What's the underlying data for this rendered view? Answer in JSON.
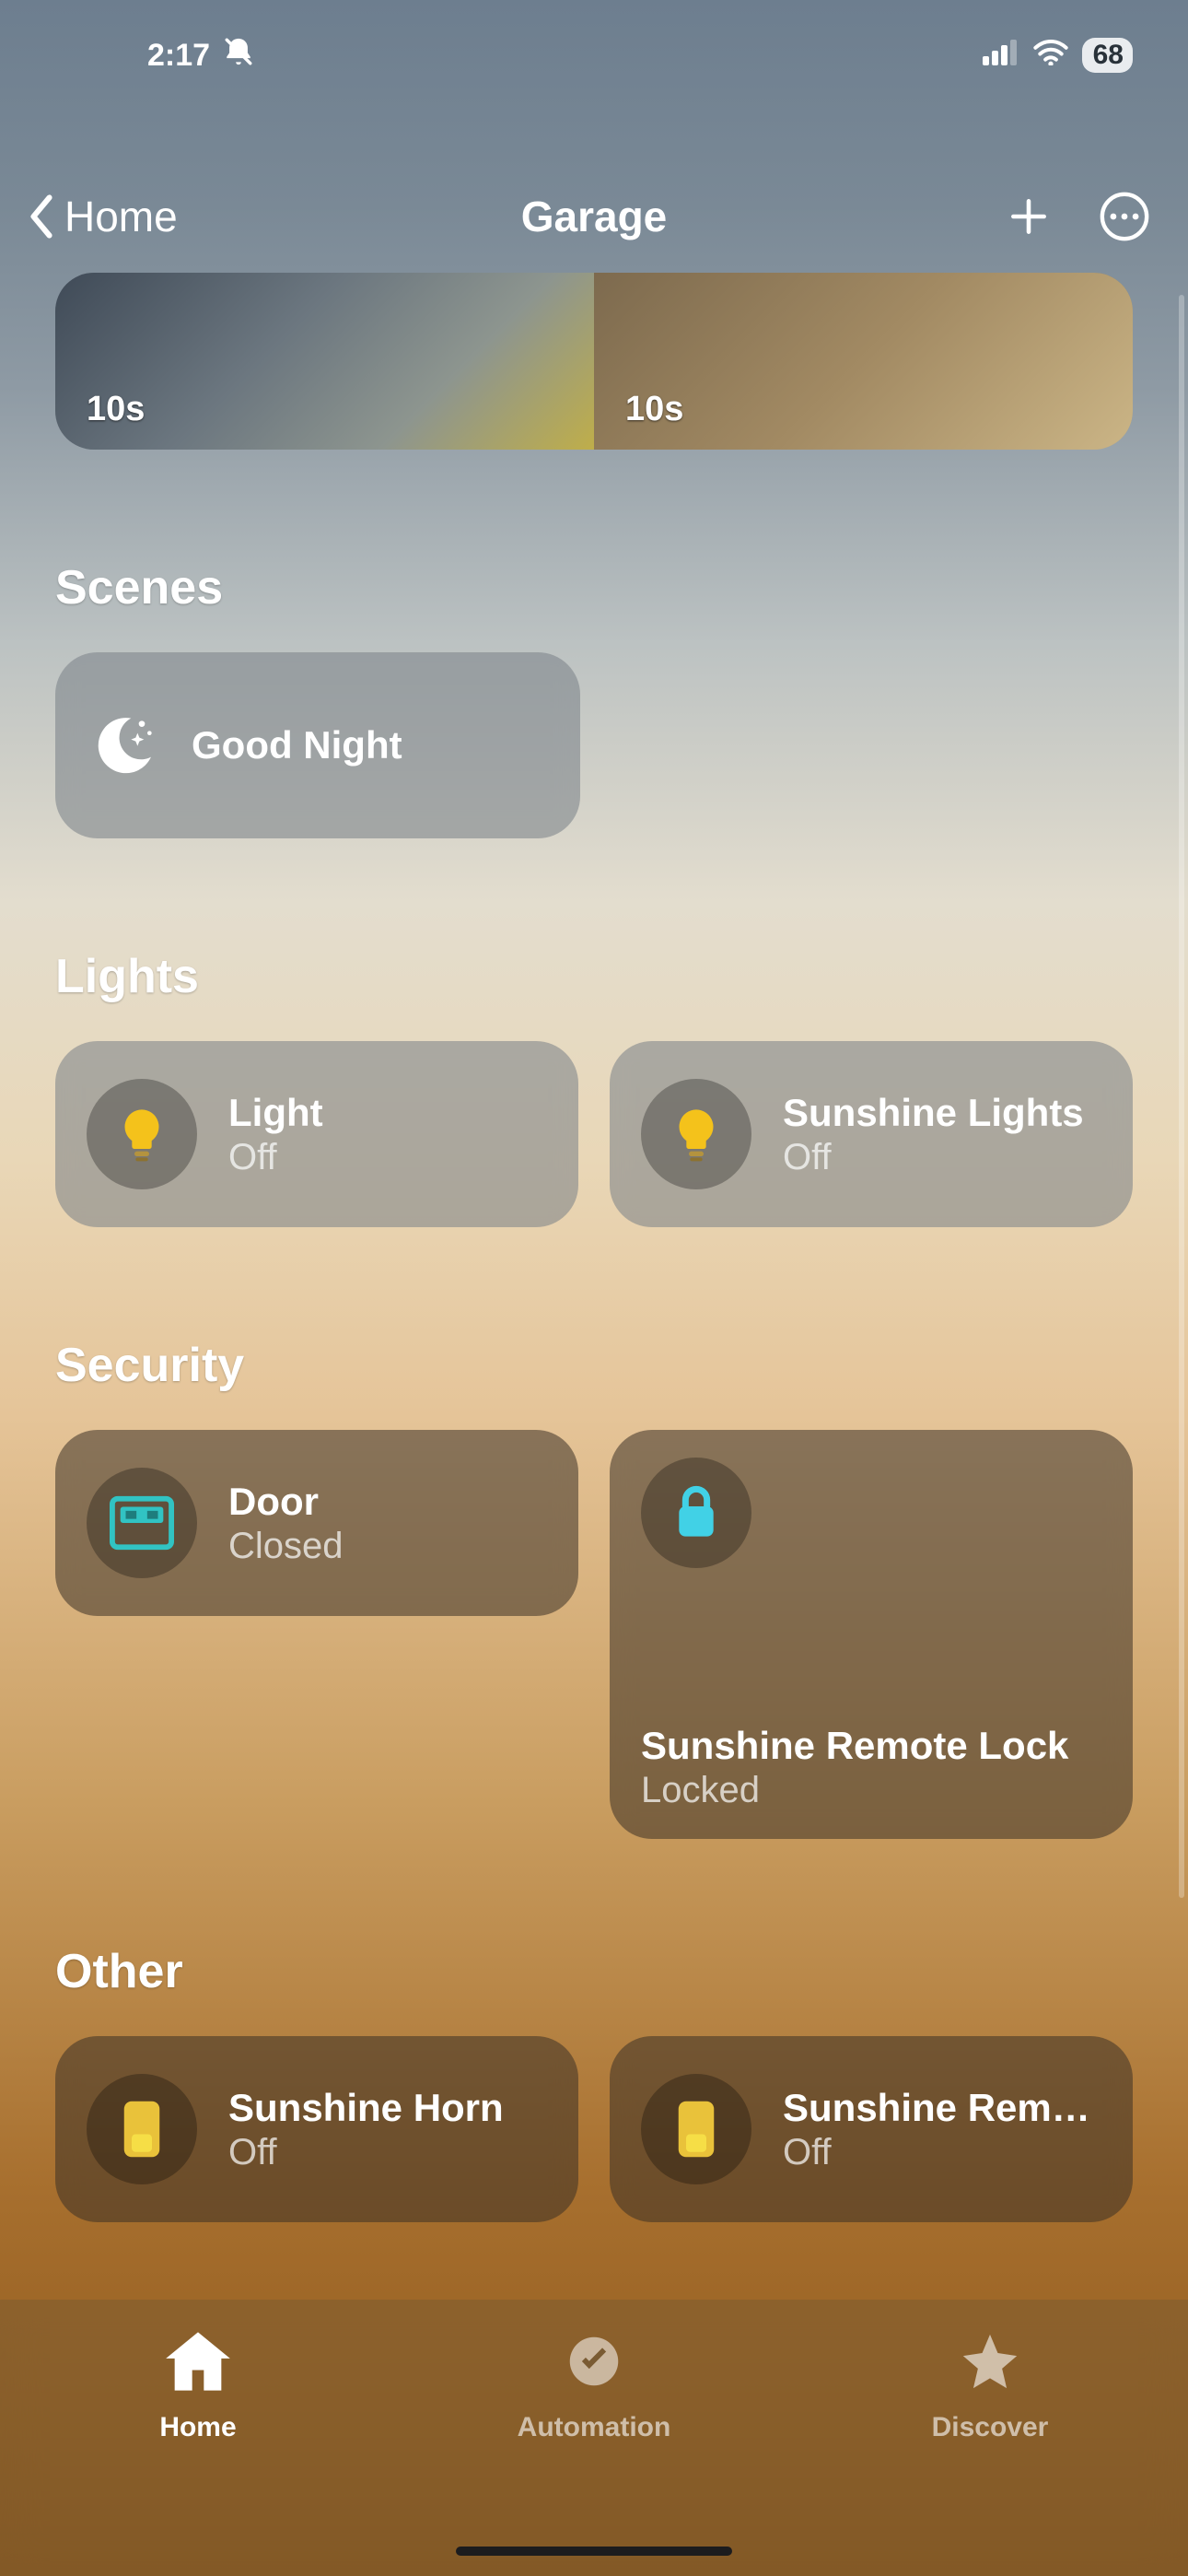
{
  "statusbar": {
    "time": "2:17",
    "battery": "68"
  },
  "header": {
    "back_label": "Home",
    "title": "Garage"
  },
  "cameras": [
    {
      "age": "10s"
    },
    {
      "age": "10s"
    }
  ],
  "sections": {
    "scenes": {
      "heading": "Scenes",
      "items": [
        {
          "name": "Good Night"
        }
      ]
    },
    "lights": {
      "heading": "Lights",
      "items": [
        {
          "name": "Light",
          "state": "Off"
        },
        {
          "name": "Sunshine Lights",
          "state": "Off"
        }
      ]
    },
    "security": {
      "heading": "Security",
      "door": {
        "name": "Door",
        "state": "Closed"
      },
      "lock": {
        "name": "Sunshine Remote Lock",
        "state": "Locked"
      }
    },
    "other": {
      "heading": "Other",
      "items": [
        {
          "name": "Sunshine Horn",
          "state": "Off"
        },
        {
          "name": "Sunshine Rem…",
          "state": "Off"
        }
      ]
    }
  },
  "tabs": {
    "home": "Home",
    "automation": "Automation",
    "discover": "Discover"
  }
}
